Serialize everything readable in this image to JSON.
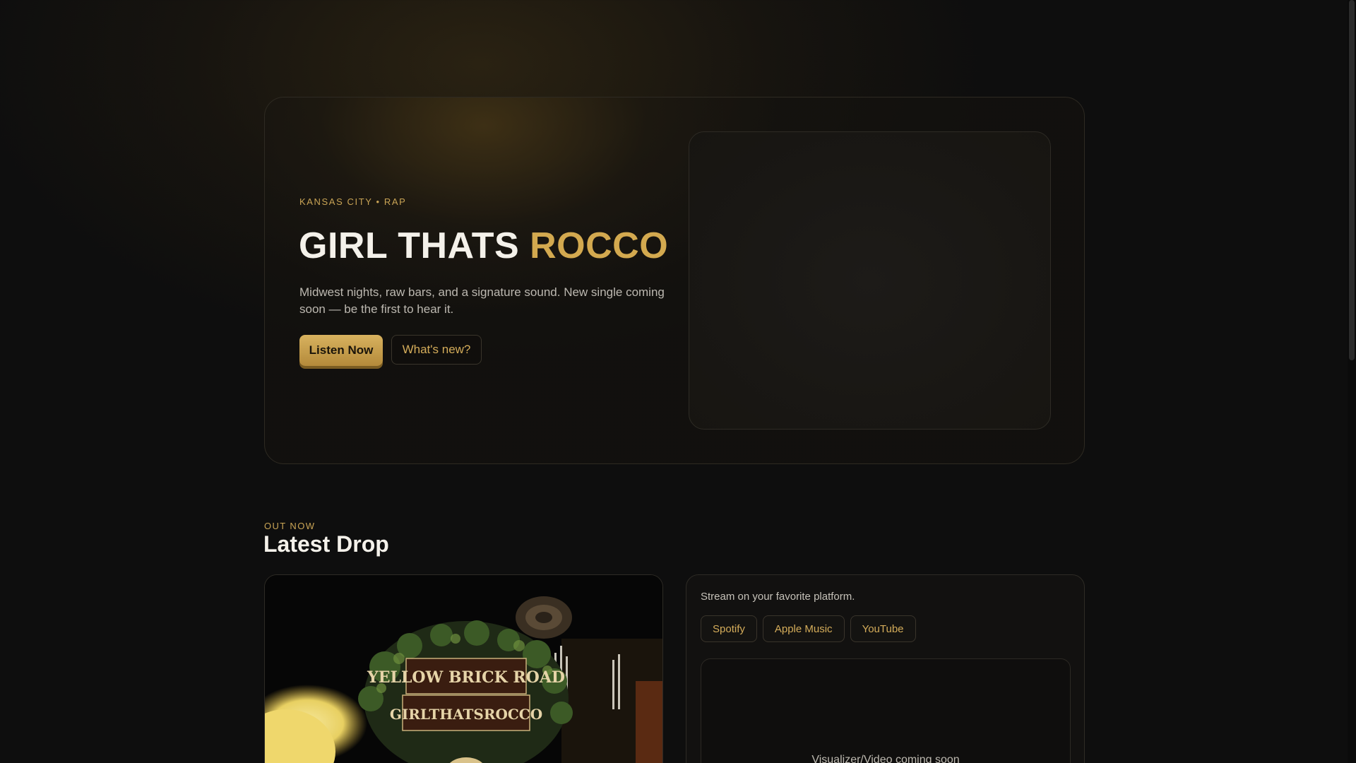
{
  "hero": {
    "eyebrow": "KANSAS CITY • RAP",
    "title_main": "GIRL THATS ",
    "title_accent": "ROCCO",
    "description": "Midwest nights, raw bars, and a signature sound. New single coming soon — be the first to hear it.",
    "primary_button": "Listen Now",
    "secondary_button": "What's new?"
  },
  "latest": {
    "eyebrow": "OUT NOW",
    "title": "Latest Drop",
    "cover": {
      "sign_line1": "YELLOW BRICK ROAD",
      "sign_line2": "GIRLTHATSROCCO"
    }
  },
  "stream": {
    "text": "Stream on your favorite platform.",
    "platforms": [
      "Spotify",
      "Apple Music",
      "YouTube"
    ],
    "video_placeholder": "Visualizer/Video coming soon"
  },
  "colors": {
    "accent": "#d3a94f",
    "background": "#0e0e0e",
    "card_border": "#2e2b25"
  }
}
